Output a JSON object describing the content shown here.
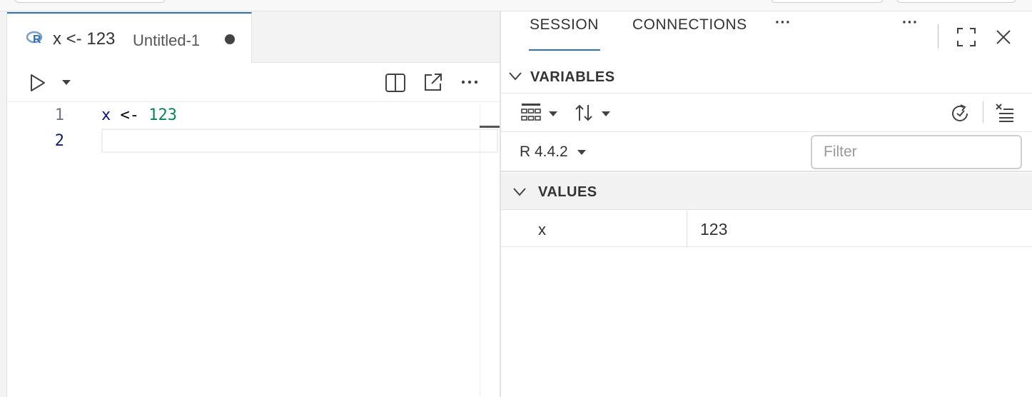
{
  "editor": {
    "tab": {
      "title": "x <- 123",
      "description": "Untitled-1",
      "language_icon": "r-logo-icon"
    },
    "lines": [
      {
        "number": "1",
        "tokens": [
          {
            "text": "x",
            "color": "#001080"
          },
          {
            "text": " <- ",
            "color": "#000000"
          },
          {
            "text": "123",
            "color": "#098658"
          }
        ]
      },
      {
        "number": "2",
        "tokens": []
      }
    ],
    "toolbar_icons": [
      "run-icon",
      "chevron-down-icon",
      "split-editor-icon",
      "open-in-new-window-icon",
      "more-actions-icon"
    ]
  },
  "panel": {
    "tabs": [
      {
        "label": "SESSION",
        "active": true
      },
      {
        "label": "CONNECTIONS",
        "active": false
      }
    ],
    "overflow_label": "···",
    "actions_label": "···",
    "variables": {
      "title": "VARIABLES",
      "session": "R 4.4.2",
      "filter_placeholder": "Filter",
      "groups": [
        {
          "title": "VALUES",
          "rows": [
            {
              "name": "x",
              "value": "123"
            }
          ]
        }
      ]
    }
  },
  "colors": {
    "accent": "#2f6fb4",
    "identifier": "#001080",
    "number": "#098658",
    "line_number_active": "#0b216f"
  }
}
